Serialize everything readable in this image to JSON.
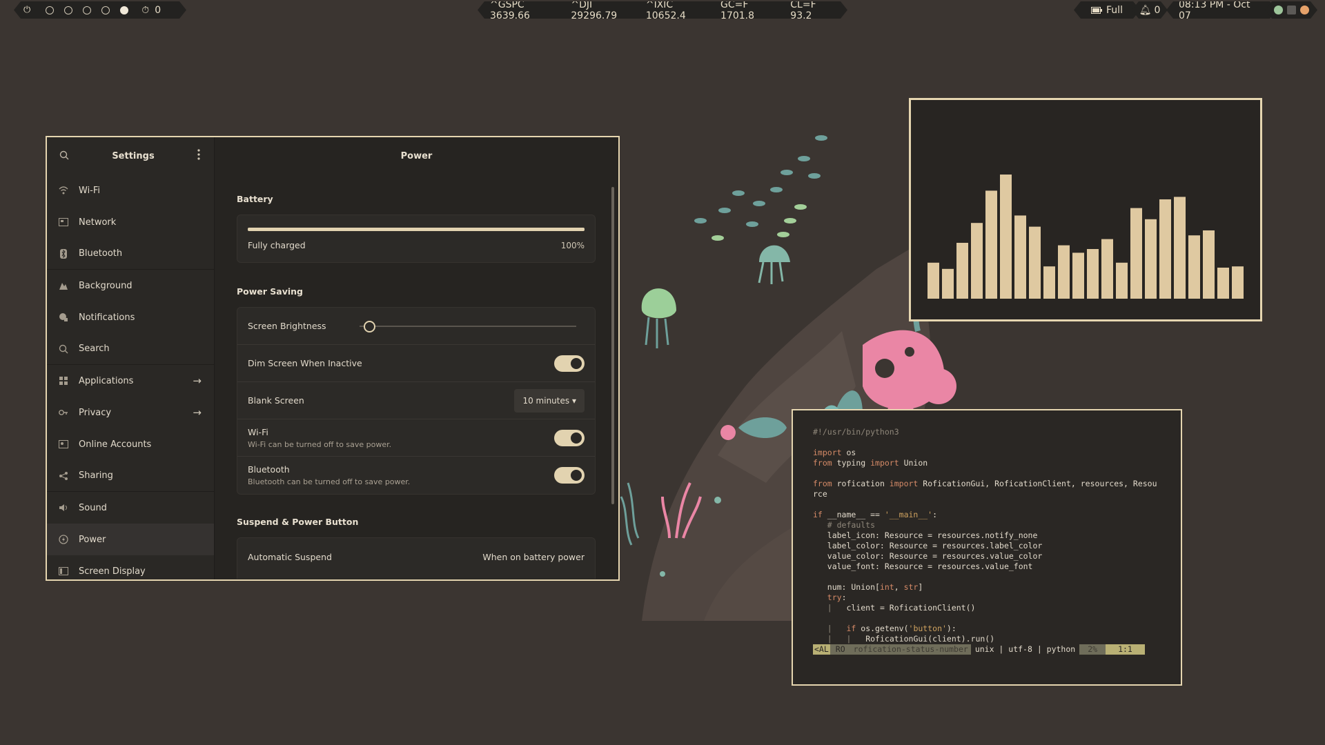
{
  "topbar": {
    "left": {
      "power_glyph": "⏻",
      "workspaces": [
        "1",
        "2",
        "3",
        "4",
        "5"
      ],
      "active_workspace": 5,
      "timer_value": "0"
    },
    "tickers": [
      {
        "label": "^GSPC 3639.66"
      },
      {
        "label": "^DJI 29296.79"
      },
      {
        "label": "^IXIC 10652.4"
      },
      {
        "label": "GC=F 1701.8"
      },
      {
        "label": "CL=F 93.2"
      }
    ],
    "battery": "Full",
    "notifications": "0",
    "clock": "08:13 PM - Oct 07"
  },
  "settings": {
    "sidebar_title": "Settings",
    "items": [
      {
        "label": "Wi-Fi",
        "icon": "wifi-icon"
      },
      {
        "label": "Network",
        "icon": "network-icon"
      },
      {
        "label": "Bluetooth",
        "icon": "bluetooth-icon"
      },
      {
        "label": "Background",
        "icon": "background-icon"
      },
      {
        "label": "Notifications",
        "icon": "notifications-icon"
      },
      {
        "label": "Search",
        "icon": "search-icon"
      },
      {
        "label": "Applications",
        "icon": "applications-icon"
      },
      {
        "label": "Privacy",
        "icon": "privacy-icon"
      },
      {
        "label": "Online Accounts",
        "icon": "online-accounts-icon"
      },
      {
        "label": "Sharing",
        "icon": "sharing-icon"
      },
      {
        "label": "Sound",
        "icon": "sound-icon"
      },
      {
        "label": "Power",
        "icon": "power-icon"
      },
      {
        "label": "Screen Display",
        "icon": "display-icon"
      }
    ],
    "page_title": "Power",
    "battery": {
      "section": "Battery",
      "status": "Fully charged",
      "percent": "100%",
      "level": 1.0
    },
    "power_saving": {
      "section": "Power Saving",
      "brightness_label": "Screen Brightness",
      "brightness_level": 0.02,
      "dim_label": "Dim Screen When Inactive",
      "blank_label": "Blank Screen",
      "blank_value": "10 minutes",
      "wifi_label": "Wi-Fi",
      "wifi_sub": "Wi-Fi can be turned off to save power.",
      "bt_label": "Bluetooth",
      "bt_sub": "Bluetooth can be turned off to save power."
    },
    "suspend": {
      "section": "Suspend & Power Button",
      "auto_label": "Automatic Suspend",
      "auto_value": "When on battery power"
    }
  },
  "visualizer": {
    "bar_color": "#dfc9a1",
    "levels": [
      0.29,
      0.24,
      0.45,
      0.61,
      0.87,
      1.0,
      0.67,
      0.58,
      0.26,
      0.43,
      0.37,
      0.4,
      0.48,
      0.29,
      0.73,
      0.64,
      0.8,
      0.82,
      0.51,
      0.55,
      0.25,
      0.26
    ]
  },
  "terminal": {
    "shebang": "#!/usr/bin/python3",
    "status": {
      "mode": "<AL",
      "ro": "RO",
      "file": "rofication-status-number",
      "info": "unix | utf-8 | python",
      "pct": "2%",
      "pos": "1:1"
    }
  }
}
